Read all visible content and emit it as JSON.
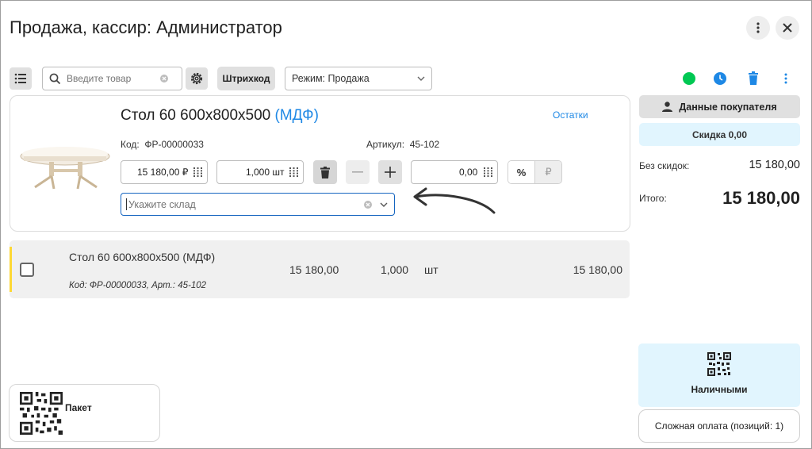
{
  "header": {
    "title": "Продажа, кассир: Администратор"
  },
  "toolbar": {
    "search_placeholder": "Введите товар",
    "barcode_label": "Штрихкод",
    "mode_label": "Режим: Продажа"
  },
  "product": {
    "name": "Стол 60 600x800x500 ",
    "name_highlight": "(МДФ)",
    "stock_link": "Остатки",
    "code_label": "Код:",
    "code_value": "ФР-00000033",
    "article_label": "Артикул:",
    "article_value": "45-102",
    "price": "15 180,00 ₽",
    "quantity": "1,000 шт",
    "discount": "0,00",
    "percent_sign": "%",
    "ruble_sign": "₽",
    "warehouse_placeholder": "Укажите склад"
  },
  "cart": {
    "rows": [
      {
        "name": "Стол 60 600x800x500 (МДФ)",
        "sub": "Код: ФР-00000033, Арт.: 45-102",
        "price": "15 180,00",
        "qty": "1,000",
        "unit": "шт",
        "total": "15 180,00"
      }
    ]
  },
  "right": {
    "customer_button": "Данные покупателя",
    "discount_button": "Скидка 0,00",
    "without_discount_label": "Без скидок:",
    "without_discount_value": "15 180,00",
    "total_label": "Итого:",
    "total_value": "15 180,00",
    "cash_button": "Наличными",
    "complex_payment": "Сложная оплата (позиций: 1)"
  },
  "package": {
    "label": "Пакет"
  },
  "colors": {
    "accent": "#1e88e5",
    "status_green": "#00c853",
    "row_marker": "#fdd835",
    "warehouse_border": "#1565c0"
  }
}
